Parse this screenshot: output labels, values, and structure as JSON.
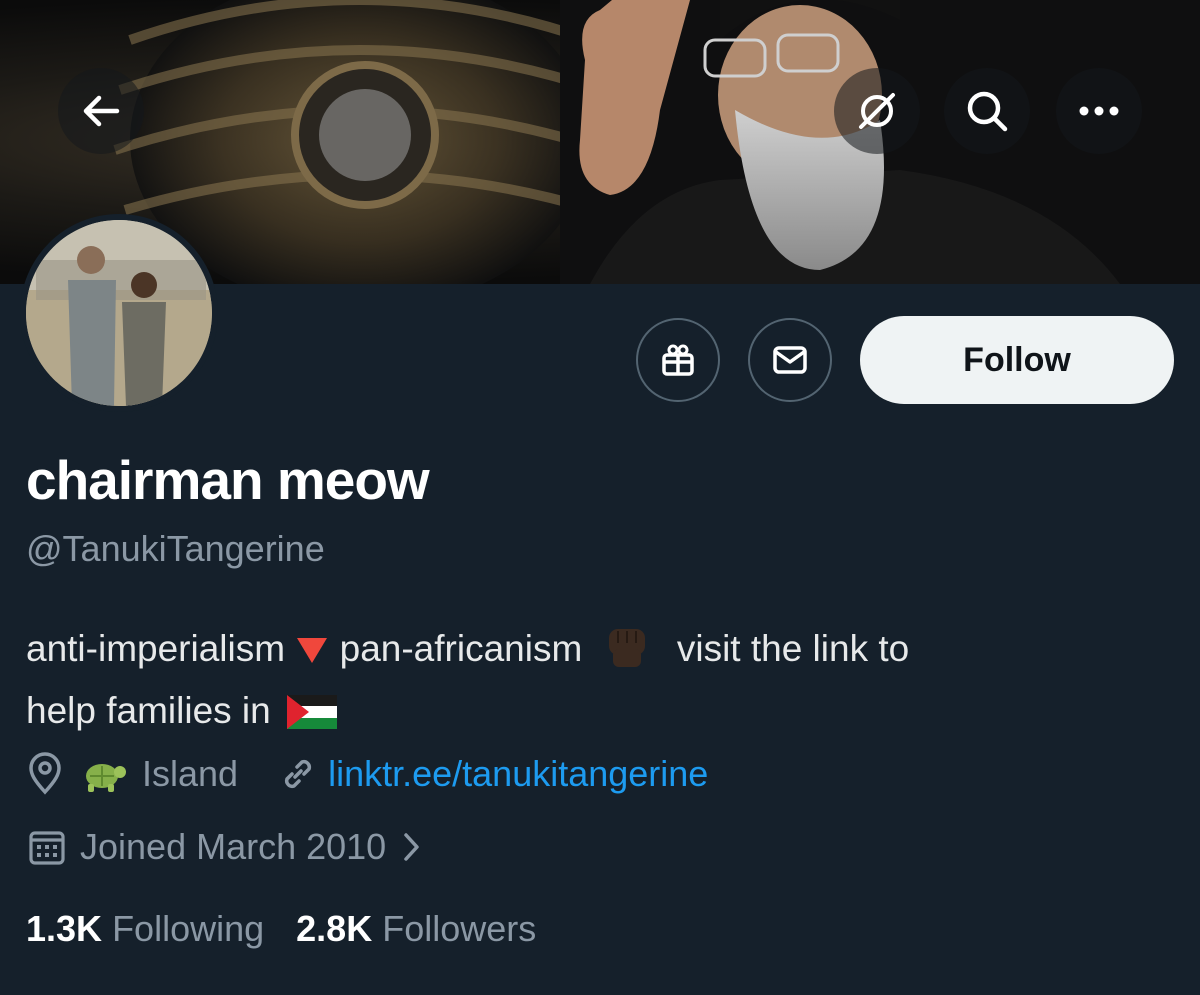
{
  "header": {
    "back_icon": "arrow-left-icon",
    "grok_icon": "grok-icon",
    "search_icon": "search-icon",
    "more_icon": "more-icon"
  },
  "profile": {
    "display_name": "chairman meow",
    "handle": "@TanukiTangerine",
    "bio_line1_a": "anti-imperialism",
    "bio_line1_b": "pan-africanism",
    "bio_line1_c": "visit the link to",
    "bio_line2": "help families in",
    "location": "Island",
    "website": "linktr.ee/tanukitangerine",
    "joined": "Joined March 2010"
  },
  "actions": {
    "gift_icon": "gift-icon",
    "message_icon": "envelope-icon",
    "follow_label": "Follow"
  },
  "stats": {
    "following_count": "1.3K",
    "following_label": "Following",
    "followers_count": "2.8K",
    "followers_label": "Followers"
  },
  "colors": {
    "background": "#15202b",
    "accent": "#1d9bf0",
    "muted": "#8b98a5",
    "button_bg": "#eff3f4"
  }
}
